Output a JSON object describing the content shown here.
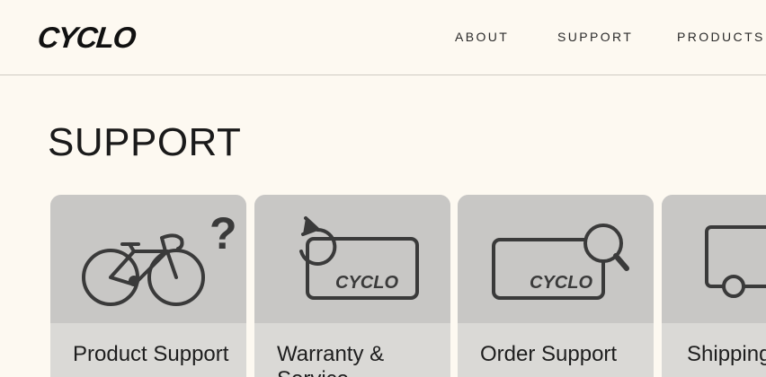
{
  "brand": {
    "logo_text": "CYCLO"
  },
  "nav": {
    "items": [
      {
        "label": "ABOUT"
      },
      {
        "label": "SUPPORT"
      },
      {
        "label": "PRODUCTS"
      }
    ]
  },
  "main": {
    "title": "SUPPORT",
    "cards": [
      {
        "label": "Product Support",
        "icon": "bike-question-icon",
        "icon_text": "?"
      },
      {
        "label": "Warranty & Service",
        "icon": "warranty-card-icon",
        "icon_text": "CYCLO"
      },
      {
        "label": "Order Support",
        "icon": "order-search-icon",
        "icon_text": "CYCLO"
      },
      {
        "label": "Shipping Policy",
        "icon": "shipping-truck-icon"
      }
    ]
  },
  "colors": {
    "background": "#fdf9f1",
    "card_media": "#c8c7c5",
    "card_body": "#dad9d6",
    "icon_stroke": "#3a3a3a"
  }
}
